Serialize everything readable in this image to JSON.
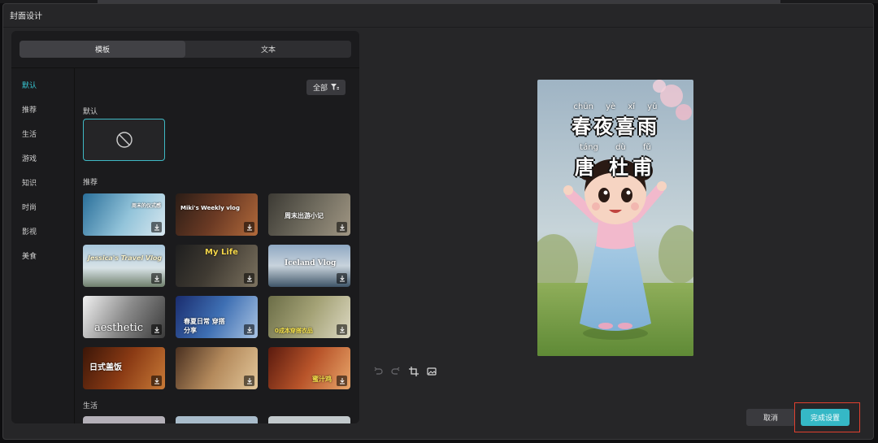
{
  "dialog": {
    "title": "封面设计"
  },
  "tabs": [
    {
      "label": "模板",
      "active": true
    },
    {
      "label": "文本",
      "active": false
    }
  ],
  "categories": [
    "默认",
    "推荐",
    "生活",
    "游戏",
    "知识",
    "时尚",
    "影视",
    "美食"
  ],
  "filter": {
    "label": "全部"
  },
  "sections": {
    "default_label": "默认",
    "recommended_label": "推荐",
    "life_label": "生活"
  },
  "templates": [
    {
      "text": "周末的仪式感"
    },
    {
      "text": "Miki's Weekly vlog"
    },
    {
      "text": "周末出游小记"
    },
    {
      "text": "Jessica's Travel Vlog"
    },
    {
      "text": "My Life"
    },
    {
      "text": "Iceland Vlog"
    },
    {
      "text": "aesthetic"
    },
    {
      "text": "春夏日常 穿搭分享"
    },
    {
      "text": "0成本穿搭衣品"
    },
    {
      "text": "日式盖饭"
    },
    {
      "text": ""
    },
    {
      "text": "蜜汁鸡"
    }
  ],
  "preview": {
    "pinyin1": "chūn yè xǐ yǔ",
    "title1": "春夜喜雨",
    "pinyin2": "táng dù fǔ",
    "title2": "唐 杜甫"
  },
  "buttons": {
    "cancel": "取消",
    "done": "完成设置"
  },
  "colors": {
    "accent": "#35b8c6",
    "highlight": "#e0402f"
  }
}
